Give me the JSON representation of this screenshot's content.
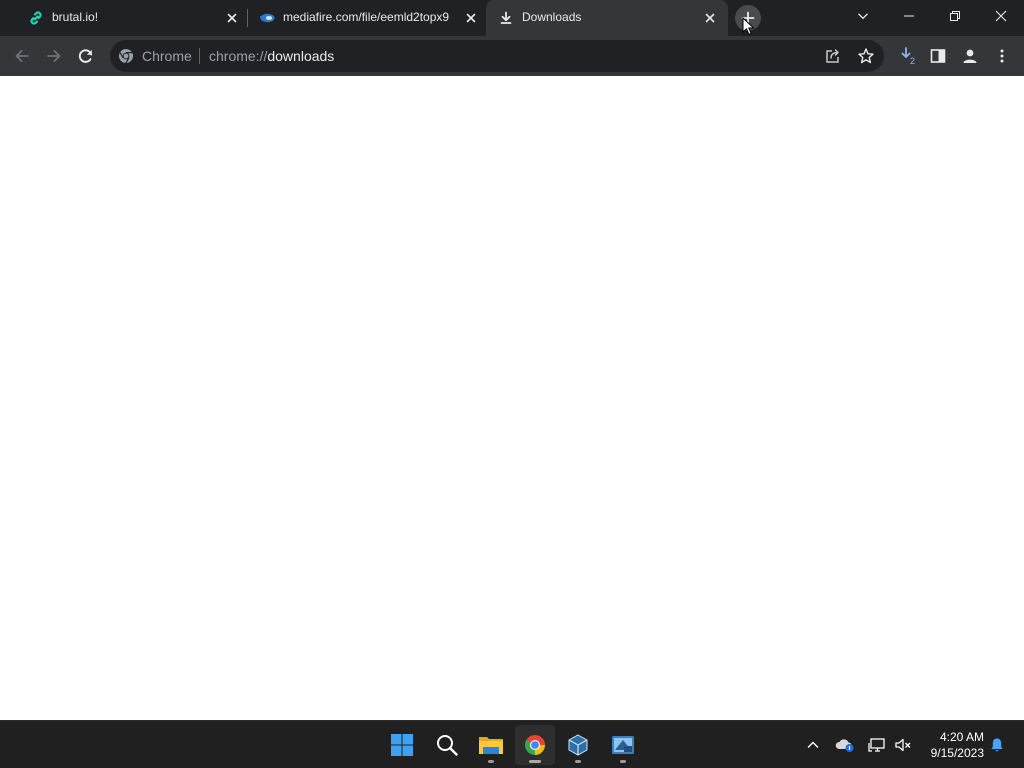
{
  "tabs": [
    {
      "title": "brutal.io!",
      "icon": "link-icon"
    },
    {
      "title": "mediafire.com/file/eemld2topx9",
      "icon": "mediafire-icon"
    },
    {
      "title": "Downloads",
      "icon": "download-icon",
      "active": true
    }
  ],
  "omnibox": {
    "origin_label": "Chrome",
    "url_scheme": "chrome://",
    "url_host": "downloads"
  },
  "toolbar": {
    "download_badge_count": "2"
  },
  "taskbar": {
    "apps": [
      {
        "name": "start",
        "icon": "windows-start-icon"
      },
      {
        "name": "search",
        "icon": "search-icon"
      },
      {
        "name": "file-explorer",
        "icon": "folder-icon",
        "running": true
      },
      {
        "name": "chrome",
        "icon": "chrome-icon",
        "running": true,
        "active": true
      },
      {
        "name": "virtualbox",
        "icon": "virtualbox-icon",
        "running": true
      },
      {
        "name": "app",
        "icon": "app-icon",
        "running": true
      }
    ],
    "clock": {
      "time": "4:20 AM",
      "date": "9/15/2023"
    }
  },
  "colors": {
    "titlebar": "#202124",
    "toolbar": "#35363a",
    "omnibox": "#202124",
    "taskbar": "#202020",
    "content": "#ffffff"
  }
}
